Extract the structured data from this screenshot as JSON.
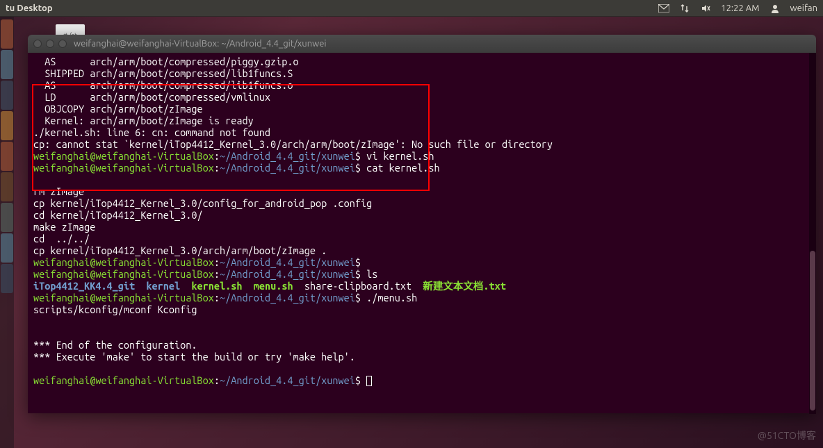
{
  "topbar": {
    "title": "tu Desktop",
    "time": "12:22 AM",
    "user": "weifan"
  },
  "desktop": {
    "file_icon_label": "# /at"
  },
  "window": {
    "title": "weifanghai@weifanghai-VirtualBox: ~/Android_4.4_git/xunwei"
  },
  "terminal": {
    "lines": [
      "  AS      arch/arm/boot/compressed/piggy.gzip.o",
      "  SHIPPED arch/arm/boot/compressed/lib1funcs.S",
      "  AS      arch/arm/boot/compressed/lib1funcs.o",
      "  LD      arch/arm/boot/compressed/vmlinux",
      "  OBJCOPY arch/arm/boot/zImage",
      "  Kernel: arch/arm/boot/zImage is ready",
      "./kernel.sh: line 6: cn: command not found",
      "cp: cannot stat `kernel/iTop4412_Kernel_3.0/arch/arm/boot/zImage': No such file or directory"
    ],
    "prompt1_cmd": "vi kernel.sh",
    "prompt2_cmd": "cat kernel.sh",
    "script_lines": [
      "",
      "rm zImage",
      "cp kernel/iTop4412_Kernel_3.0/config_for_android_pop .config",
      "cd kernel/iTop4412_Kernel_3.0/",
      "make zImage",
      "cd  ../../",
      "cp kernel/iTop4412_Kernel_3.0/arch/arm/boot/zImage ."
    ],
    "prompt3_cmd": "ls",
    "ls_items": {
      "dirs": [
        "iTop4412_KK4.4_git",
        "kernel"
      ],
      "execs": [
        "kernel.sh",
        "menu.sh"
      ],
      "files": [
        "share-clipboard.txt"
      ],
      "special": "新建文本文档.txt"
    },
    "prompt4_cmd": "./menu.sh",
    "menu_output": "scripts/kconfig/mconf Kconfig",
    "config_end": [
      "",
      "",
      "*** End of the configuration.",
      "*** Execute 'make' to start the build or try 'make help'.",
      ""
    ],
    "prompt_user": "weifanghai@weifanghai-VirtualBox",
    "prompt_path": "~/Android_4.4_git/xunwei"
  },
  "watermark": "@51CTO博客"
}
